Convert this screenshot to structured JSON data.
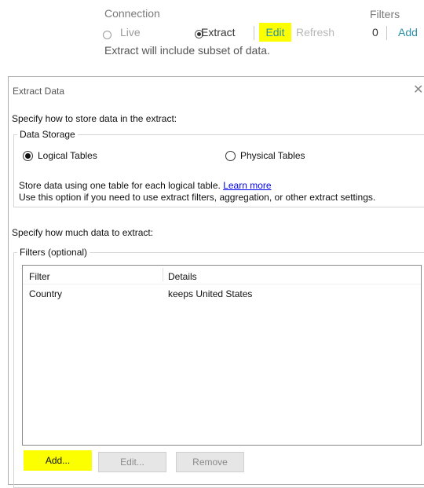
{
  "connection": {
    "title": "Connection",
    "live_label": "Live",
    "extract_label": "Extract",
    "edit_label": "Edit",
    "refresh_label": "Refresh",
    "subset_note": "Extract will include subset of data.",
    "selected": "Extract"
  },
  "filters": {
    "title": "Filters",
    "count": "0",
    "add_label": "Add"
  },
  "dialog": {
    "title": "Extract Data",
    "close_icon": "close-icon",
    "store_heading": "Specify how to store data in the extract:",
    "data_storage": {
      "label": "Data Storage",
      "options": [
        "Logical Tables",
        "Physical Tables"
      ],
      "selected": "Logical Tables",
      "desc_line1": "Store data using one table for each logical table.",
      "learn_more": "Learn more",
      "desc_line2": "Use this option if you need to use extract filters, aggregation, or other extract settings."
    },
    "how_heading": "Specify how much data to extract:",
    "filters_optional": {
      "label": "Filters (optional)",
      "columns": [
        "Filter",
        "Details"
      ],
      "rows": [
        {
          "filter": "Country",
          "details": "keeps United States"
        }
      ]
    },
    "buttons": {
      "add": "Add...",
      "edit": "Edit...",
      "remove": "Remove"
    }
  },
  "colors": {
    "highlight": "#fbff00",
    "link": "#2a8fa8"
  }
}
